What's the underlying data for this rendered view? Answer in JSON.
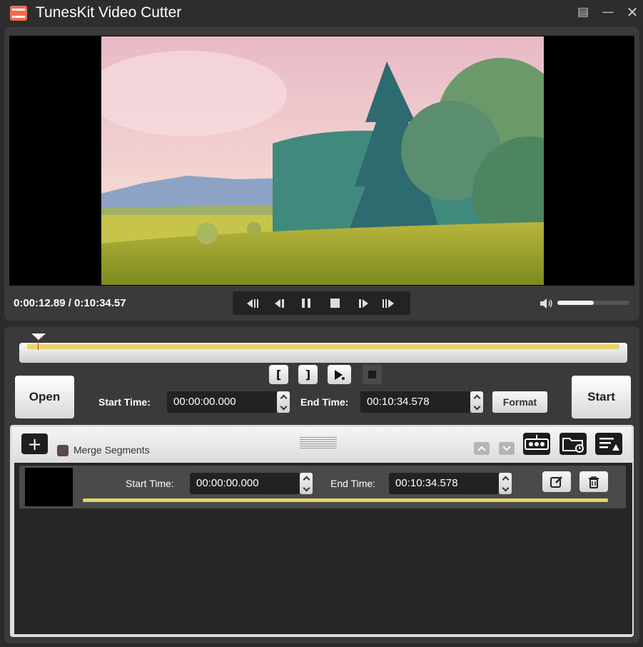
{
  "app": {
    "title": "TunesKit Video Cutter"
  },
  "player": {
    "time_readout": "0:00:12.89 / 0:10:34.57",
    "volume_level": 0.5
  },
  "editor": {
    "open_label": "Open",
    "start_label": "Start",
    "start_time_label": "Start Time:",
    "start_time_value": "00:00:00.000",
    "end_time_label": "End Time:",
    "end_time_value": "00:10:34.578",
    "format_label": "Format"
  },
  "segments": {
    "merge_label": "Merge Segments",
    "items": [
      {
        "start_label": "Start Time:",
        "start_value": "00:00:00.000",
        "end_label": "End Time:",
        "end_value": "00:10:34.578"
      }
    ]
  },
  "colors": {
    "accent_yellow": "#e6d46b",
    "app_icon": "#f56a4a"
  }
}
